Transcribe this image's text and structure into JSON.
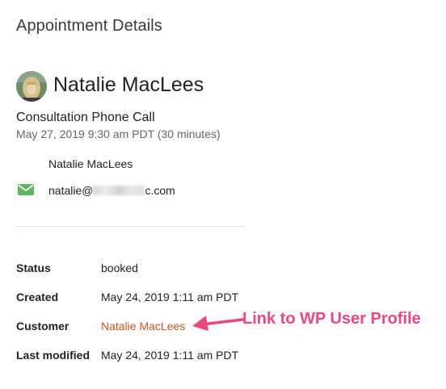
{
  "page": {
    "title": "Appointment Details"
  },
  "customer": {
    "name": "Natalie MacLees"
  },
  "appointment": {
    "service": "Consultation Phone Call",
    "datetime": "May 27, 2019 9:30 am PDT (30 minutes)"
  },
  "contact": {
    "name": "Natalie MacLees",
    "email_prefix": "natalie@",
    "email_suffix": "c.com",
    "email_icon": "mail-icon"
  },
  "details": [
    {
      "label": "Status",
      "value": "booked"
    },
    {
      "label": "Created",
      "value": "May 24, 2019 1:11 am PDT"
    },
    {
      "label": "Customer",
      "value": "Natalie MacLees"
    },
    {
      "label": "Last modified",
      "value": "May 24, 2019 1:11 am PDT"
    }
  ],
  "annotation": {
    "text": "Link to WP User Profile",
    "color": "#f0467e"
  },
  "colors": {
    "link": "#d9531e",
    "email_icon": "#5cb85c"
  }
}
